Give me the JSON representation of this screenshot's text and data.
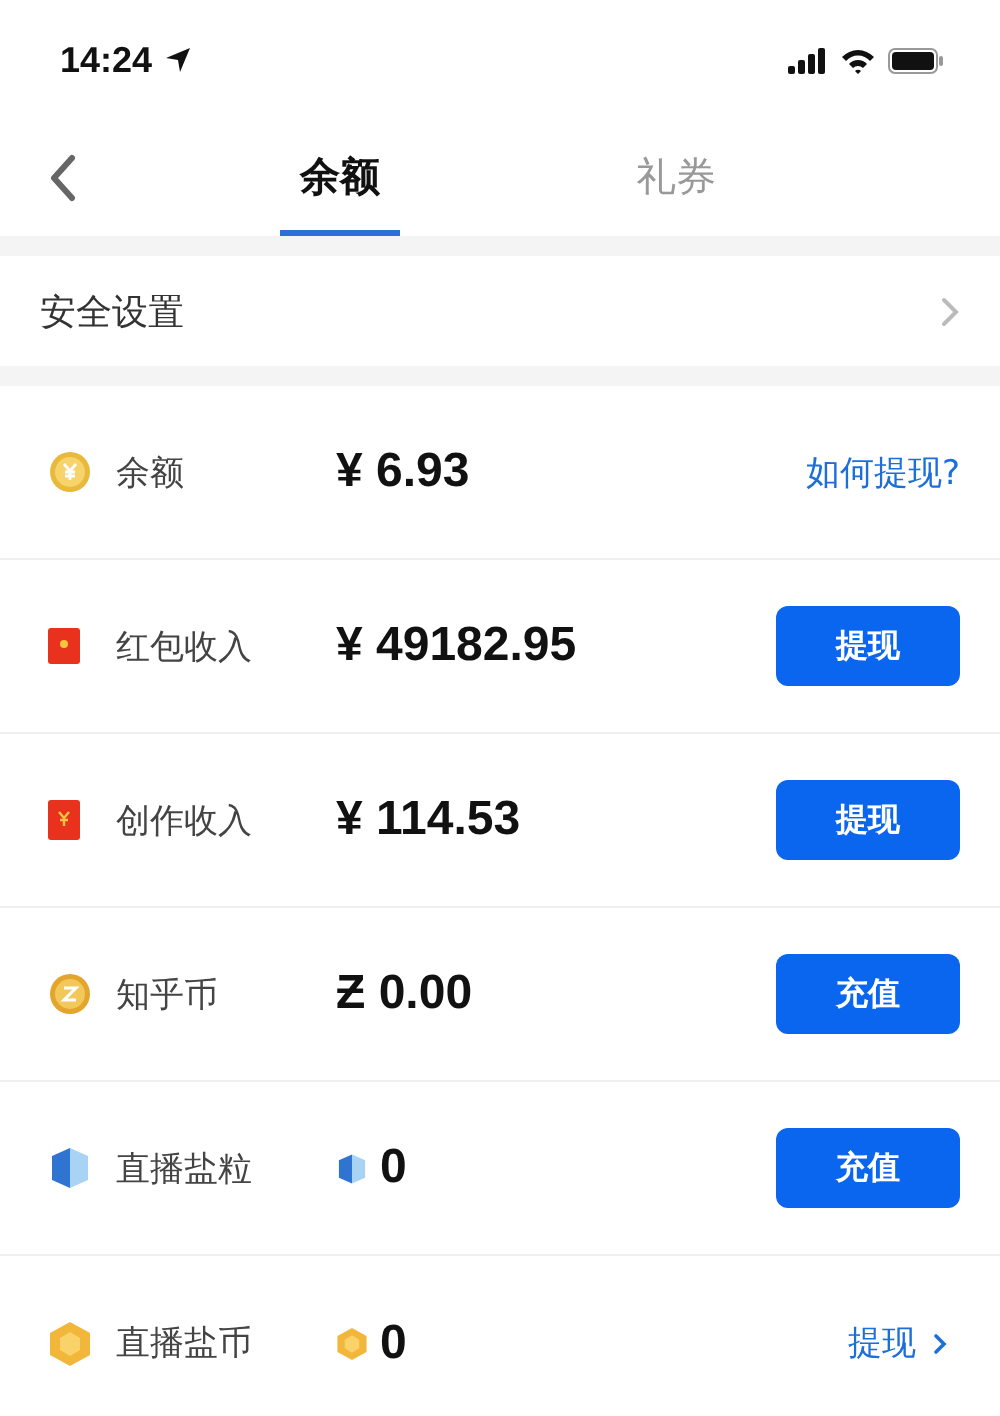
{
  "status_bar": {
    "time": "14:24"
  },
  "tabs": [
    {
      "label": "余额",
      "selected": true
    },
    {
      "label": "礼券",
      "selected": false
    }
  ],
  "settings_row": {
    "label": "安全设置"
  },
  "accounts": [
    {
      "name": "余额",
      "amount": "¥ 6.93",
      "action": {
        "kind": "link",
        "label": "如何提现?"
      }
    },
    {
      "name": "红包收入",
      "amount": "¥ 49182.95",
      "action": {
        "kind": "button",
        "label": "提现"
      }
    },
    {
      "name": "创作收入",
      "amount": "¥ 114.53",
      "action": {
        "kind": "button",
        "label": "提现"
      }
    },
    {
      "name": "知乎币",
      "amount": "Ƶ 0.00",
      "action": {
        "kind": "button",
        "label": "充值"
      }
    },
    {
      "name": "直播盐粒",
      "amount": "0",
      "action": {
        "kind": "button",
        "label": "充值"
      }
    },
    {
      "name": "直播盐币",
      "amount": "0",
      "action": {
        "kind": "arrow-link",
        "label": "提现"
      }
    }
  ]
}
